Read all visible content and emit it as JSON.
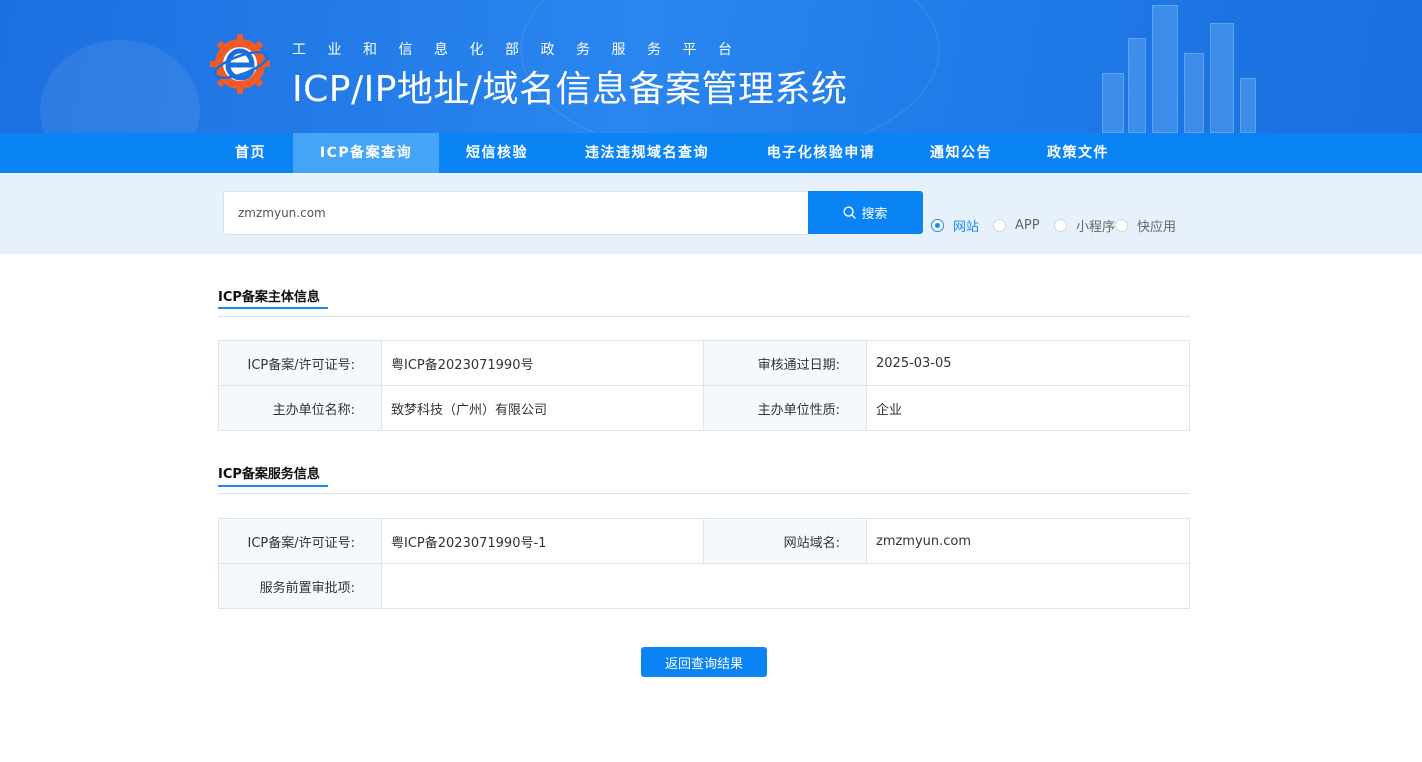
{
  "header": {
    "subtitle": "工业和信息化部政务服务平台",
    "title": "ICP/IP地址/域名信息备案管理系统"
  },
  "nav": {
    "items": [
      {
        "label": "首页"
      },
      {
        "label": "ICP备案查询",
        "active": true
      },
      {
        "label": "短信核验"
      },
      {
        "label": "违法违规域名查询"
      },
      {
        "label": "电子化核验申请"
      },
      {
        "label": "通知公告"
      },
      {
        "label": "政策文件"
      }
    ]
  },
  "search": {
    "value": "zmzmyun.com",
    "button_label": "搜索",
    "types": [
      {
        "label": "网站",
        "checked": true
      },
      {
        "label": "APP",
        "checked": false
      },
      {
        "label": "小程序",
        "checked": false
      },
      {
        "label": "快应用",
        "checked": false
      }
    ]
  },
  "subject_info": {
    "title": "ICP备案主体信息",
    "license_label": "ICP备案/许可证号:",
    "license_value": "粤ICP备2023071990号",
    "approve_date_label": "审核通过日期:",
    "approve_date_value": "2025-03-05",
    "org_name_label": "主办单位名称:",
    "org_name_value": "致梦科技（广州）有限公司",
    "org_type_label": "主办单位性质:",
    "org_type_value": "企业"
  },
  "service_info": {
    "title": "ICP备案服务信息",
    "license_label": "ICP备案/许可证号:",
    "license_value": "粤ICP备2023071990号-1",
    "domain_label": "网站域名:",
    "domain_value": "zmzmyun.com",
    "approval_label": "服务前置审批项:",
    "approval_value": ""
  },
  "back_button_label": "返回查询结果",
  "colors": {
    "primary": "#0a84f5",
    "nav_active": "#44a5f6",
    "search_band": "#e7f1fc",
    "logo_orange": "#f15a24"
  }
}
